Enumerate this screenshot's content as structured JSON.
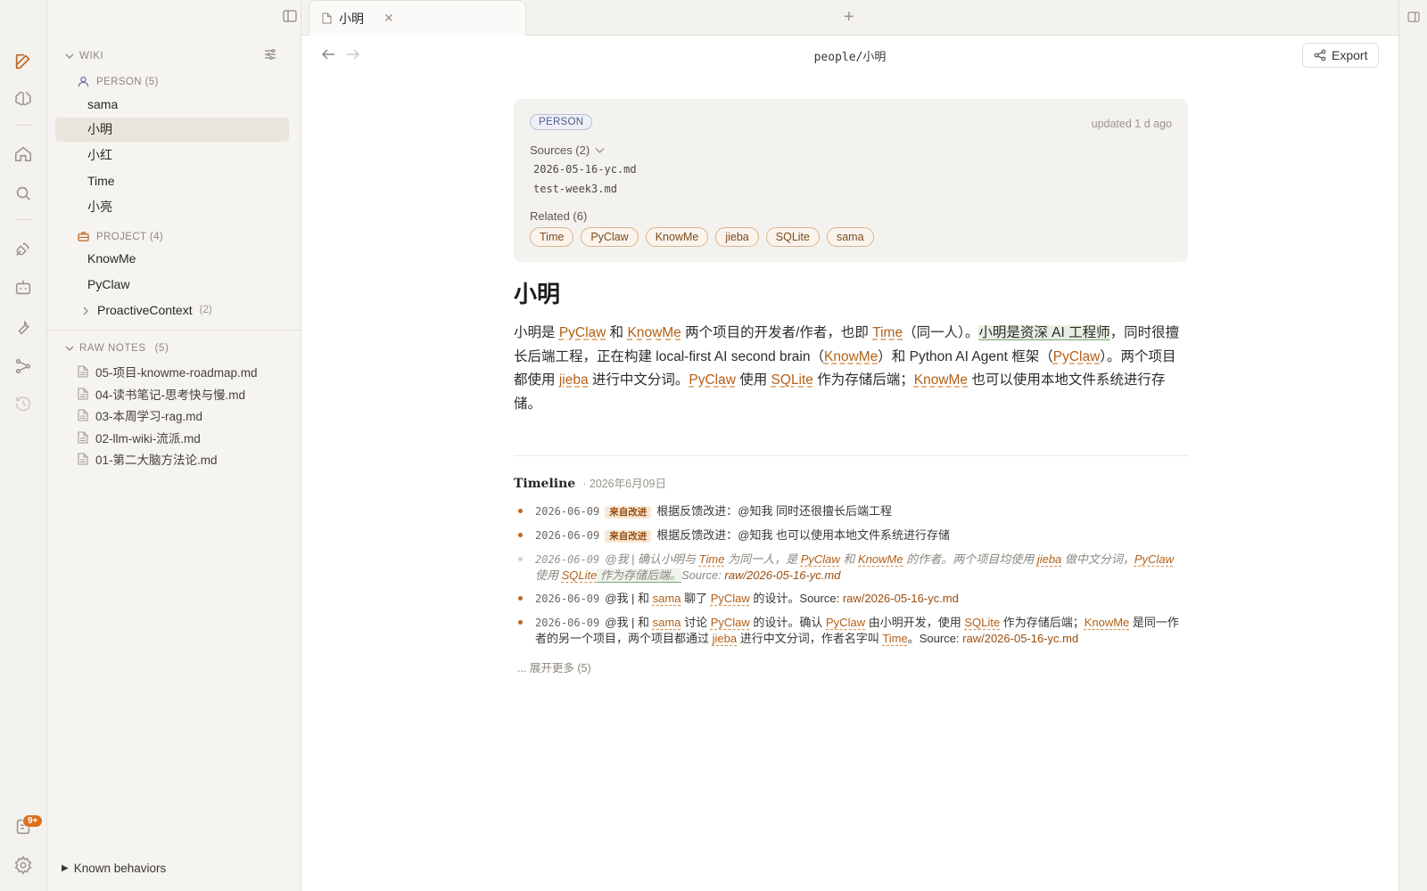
{
  "rail": {
    "icons": [
      "edit-icon",
      "brain-icon",
      "home-icon",
      "search-icon",
      "plug-icon",
      "bot-icon",
      "wrench-icon",
      "graph-icon",
      "history-icon",
      "clipboard-icon",
      "settings-icon"
    ],
    "badge": "9+"
  },
  "sidebar": {
    "wiki_label": "WIKI",
    "person_group": "PERSON (5)",
    "persons": [
      "sama",
      "小明",
      "小红",
      "Time",
      "小亮"
    ],
    "selected": "小明",
    "project_group": "PROJECT (4)",
    "projects": [
      "KnowMe",
      "PyClaw"
    ],
    "sub_project": "ProactiveContext",
    "sub_project_count": "(2)",
    "raw_notes_label": "RAW NOTES",
    "raw_notes_count": "(5)",
    "raw_notes": [
      "05-项目-knowme-roadmap.md",
      "04-读书笔记-思考快与慢.md",
      "03-本周学习-rag.md",
      "02-llm-wiki-流派.md",
      "01-第二大脑方法论.md"
    ],
    "known_behaviors": "Known behaviors"
  },
  "tabs": [
    {
      "label": "小明"
    }
  ],
  "breadcrumb": "people/小明",
  "export_label": "Export",
  "meta": {
    "type": "PERSON",
    "updated": "updated 1 d ago",
    "sources_label": "Sources (2)",
    "sources": [
      "2026-05-16-yc.md",
      "test-week3.md"
    ],
    "related_label": "Related (6)",
    "related": [
      "Time",
      "PyClaw",
      "KnowMe",
      "jieba",
      "SQLite",
      "sama"
    ]
  },
  "doc": {
    "title": "小明",
    "p": {
      "s1": "小明是 ",
      "l1": "PyClaw",
      "s2": " 和 ",
      "l2": "KnowMe",
      "s3": " 两个项目的开发者/作者，也即 ",
      "l3": "Time",
      "s4": "（同一人）。",
      "hl": "小明是资深 AI 工程师",
      "s5": "，同时很擅长后端工程，正在构建 local-first AI second brain（",
      "l4": "KnowMe",
      "s6": "）和 Python AI Agent 框架（",
      "l5": "PyClaw",
      "s7": "）。两个项目都使用 ",
      "l6": "jieba",
      "s8": " 进行中文分词。",
      "l7": "PyClaw",
      "s9": " 使用 ",
      "l8": "SQLite",
      "s10": " 作为存储后端；",
      "l9": "KnowMe",
      "s11": " 也可以使用本地文件系统进行存储。"
    }
  },
  "timeline": {
    "title": "Timeline",
    "date": "· 2026年6月09日",
    "tag": "来自改进",
    "e1": {
      "date": "2026-06-09",
      "text": "根据反馈改进：@知我 同时还很擅长后端工程"
    },
    "e2": {
      "date": "2026-06-09",
      "text": "根据反馈改进：@知我 也可以使用本地文件系统进行存储"
    },
    "e3": {
      "date": "2026-06-09",
      "a": "@我 | 确认小明与 ",
      "l1": "Time",
      "b": " 为同一人，是 ",
      "l2": "PyClaw",
      "c": " 和 ",
      "l3": "KnowMe",
      "d": " 的作者。两个项目均使用 ",
      "l4": "jieba",
      "e": " 做中文分词，",
      "l5": "PyClaw",
      "f": " 使用 ",
      "l6": "SQLite",
      "g": " 作为存储后端。",
      "h": "Source: ",
      "src": "raw/2026-05-16-yc.md"
    },
    "e4": {
      "date": "2026-06-09",
      "a": "@我 | 和 ",
      "l1": "sama",
      "b": " 聊了 ",
      "l2": "PyClaw",
      "c": " 的设计。Source: ",
      "src": "raw/2026-05-16-yc.md"
    },
    "e5": {
      "date": "2026-06-09",
      "a": "@我 | 和 ",
      "l1": "sama",
      "b": " 讨论 ",
      "l2": "PyClaw",
      "c": " 的设计。确认 ",
      "l3": "PyClaw",
      "d": " 由小明开发，使用 ",
      "l4": "SQLite",
      "e": " 作为存储后端；",
      "l5": "KnowMe",
      "f": " 是同一作者的另一个项目，两个项目都通过 ",
      "l6": "jieba",
      "g": " 进行中文分词，作者名字叫 ",
      "l7": "Time",
      "h": "。Source: ",
      "src": "raw/2026-05-16-yc.md"
    },
    "more": "... 展开更多 (5)"
  }
}
